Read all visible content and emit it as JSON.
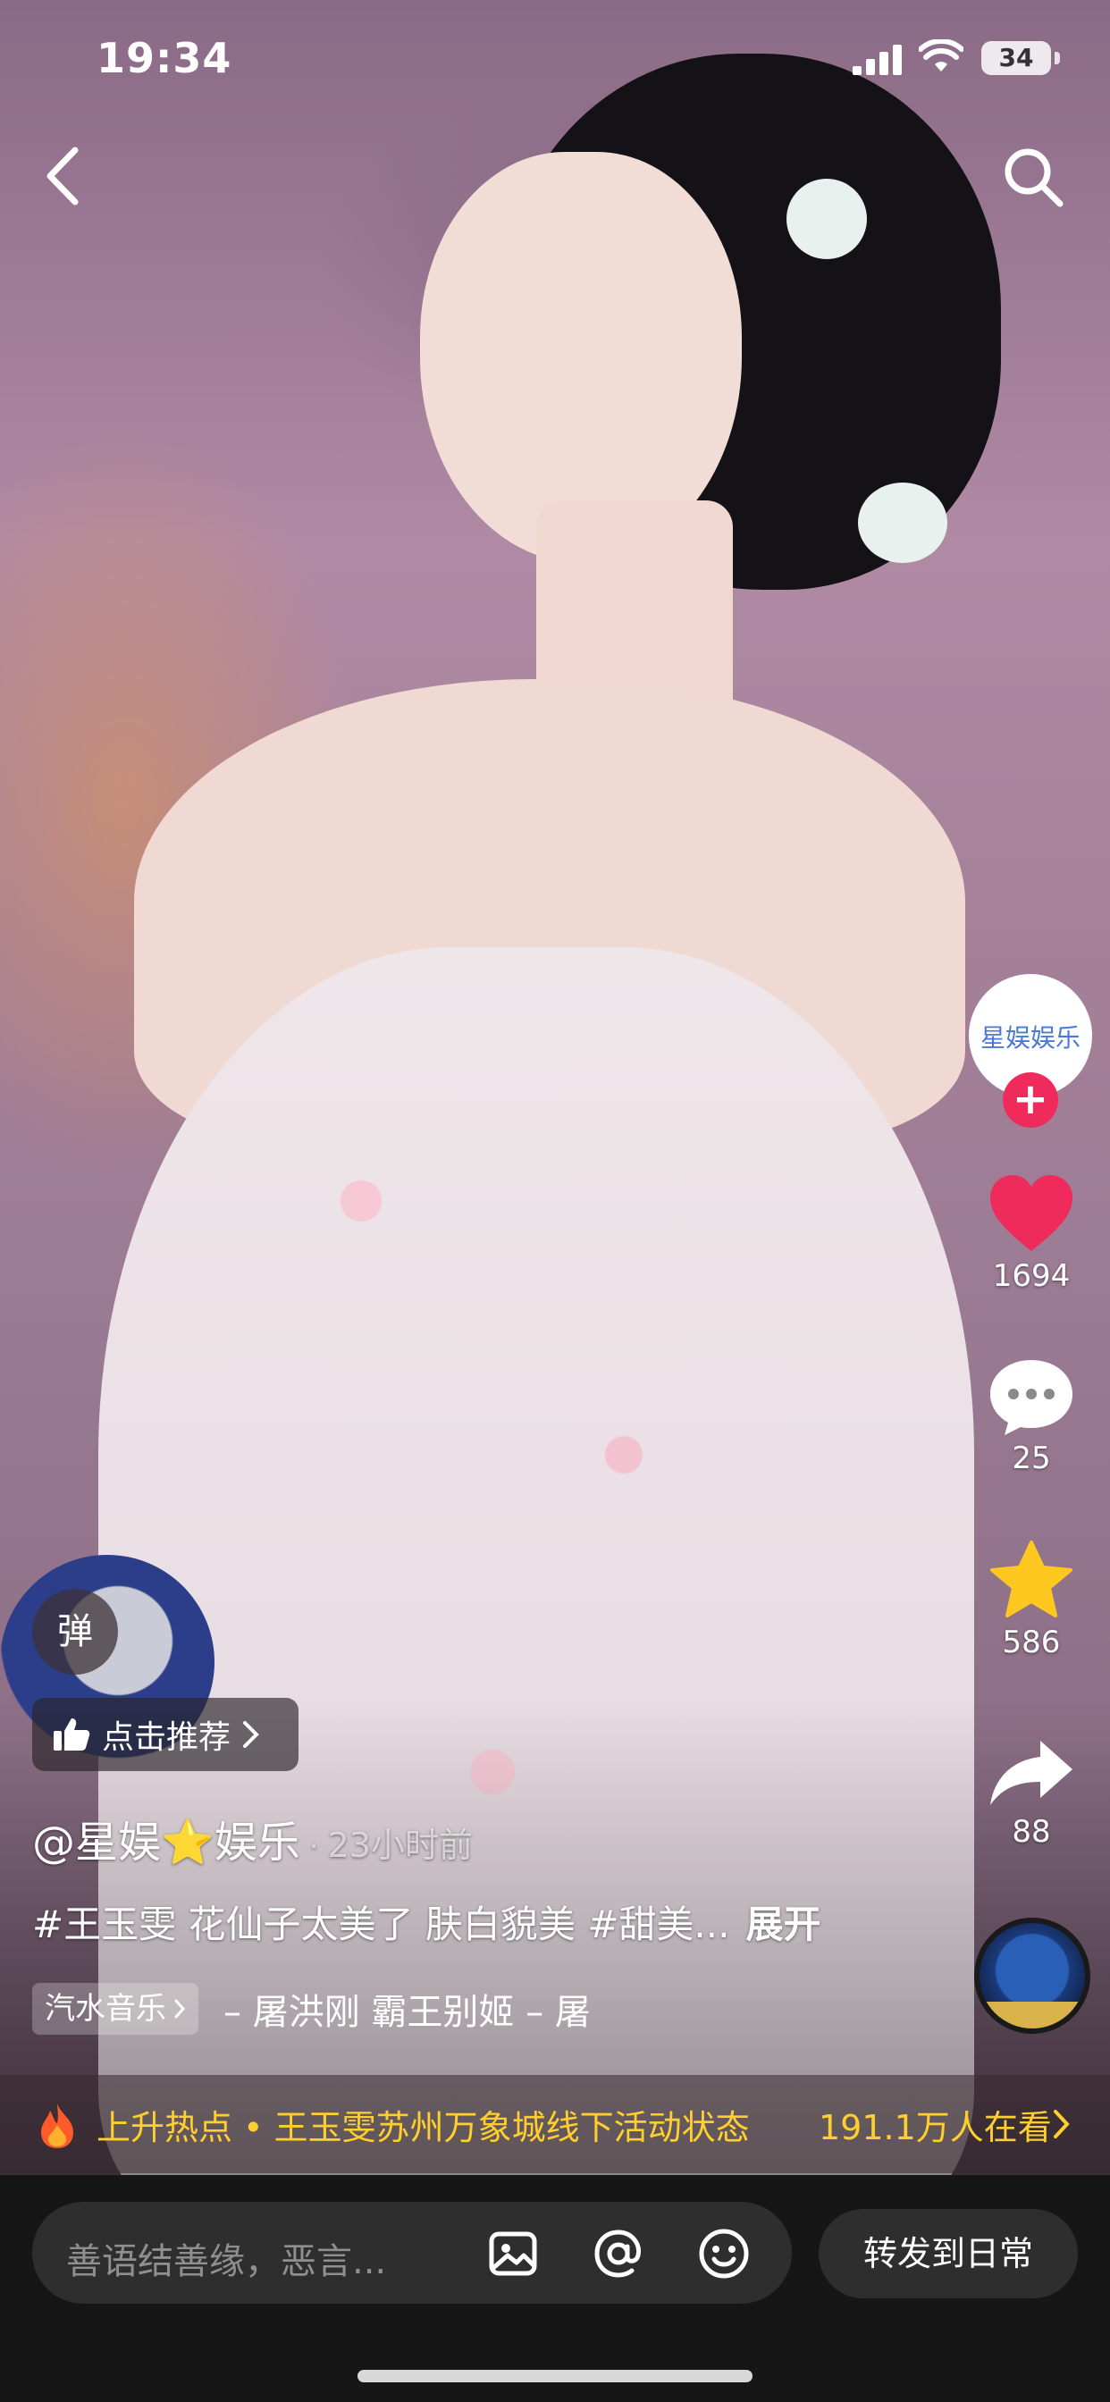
{
  "status_bar": {
    "time": "19:34",
    "battery": "34",
    "icons": [
      "cellular-signal-icon",
      "wifi-icon",
      "battery-icon"
    ]
  },
  "top_bar": {
    "back_icon": "chevron-left-icon",
    "search_icon": "search-icon"
  },
  "right_rail": {
    "avatar_text": "星娱娱乐",
    "follow_icon": "plus-icon",
    "like": {
      "icon": "heart-icon",
      "count": "1694",
      "color": "#ee2b5a"
    },
    "comment": {
      "icon": "comment-bubble-icon",
      "count": "25"
    },
    "favorite": {
      "icon": "star-icon",
      "count": "586",
      "color": "#ffc820"
    },
    "share": {
      "icon": "share-arrow-icon",
      "count": "88"
    },
    "music_disc_icon": "music-disc-icon"
  },
  "danmu": {
    "label": "弹"
  },
  "recommend": {
    "label": "点击推荐",
    "icon": "thumbs-up-icon"
  },
  "post": {
    "author_prefix": "@星娱",
    "author_star": "⭐",
    "author_suffix": "娱乐",
    "separator": "·",
    "time_ago": "23小时前",
    "caption": "#王玉雯 花仙子太美了 肤白貌美 #甜美...",
    "expand": "展开",
    "music_tag": "汽水音乐",
    "music_title": "– 屠洪刚   霸王别姬 – 屠"
  },
  "hot_bar": {
    "icon": "flame-icon",
    "text": "上升热点 • 王玉雯苏州万象城线下活动状态",
    "viewers": "191.1万人在看",
    "accent": "#ffcf2e"
  },
  "bottom_bar": {
    "comment_placeholder": "善语结善缘，恶言...",
    "icons": [
      "image-icon",
      "at-icon",
      "emoji-icon"
    ],
    "share_label": "转发到日常"
  }
}
